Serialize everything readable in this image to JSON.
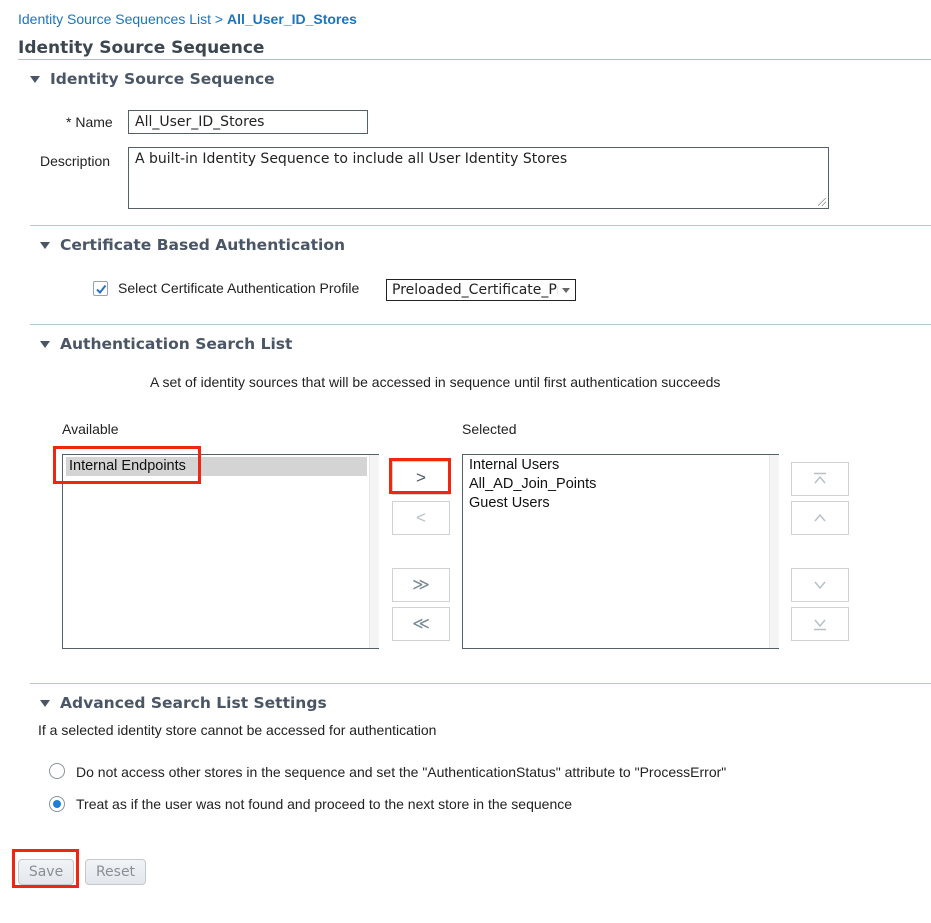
{
  "breadcrumb": {
    "parent": "Identity Source Sequences List",
    "separator": ">",
    "current": "All_User_ID_Stores"
  },
  "page_title": "Identity Source Sequence",
  "sections": {
    "identity": {
      "title": "Identity Source Sequence",
      "name_label": "* Name",
      "name_value": "All_User_ID_Stores",
      "description_label": "Description",
      "description_value": "A built-in Identity Sequence to include all User Identity Stores"
    },
    "certificate": {
      "title": "Certificate Based Authentication",
      "checkbox_label": "Select Certificate Authentication Profile",
      "checkbox_checked": true,
      "profile_selected": "Preloaded_Certificate_Pr"
    },
    "search_list": {
      "title": "Authentication Search List",
      "description": "A set of identity sources that will be accessed in sequence until first authentication succeeds",
      "available_label": "Available",
      "selected_label": "Selected",
      "available_items": [
        "Internal Endpoints"
      ],
      "selected_items": [
        "Internal Users",
        "All_AD_Join_Points",
        "Guest Users"
      ],
      "move_buttons": {
        "add": ">",
        "remove": "<",
        "add_all": "≫",
        "remove_all": "≪"
      },
      "order_buttons": {
        "top": "⤒",
        "up": "^",
        "down": "v",
        "bottom": "⤓"
      }
    },
    "advanced": {
      "title": "Advanced Search List Settings",
      "intro": "If a selected identity store cannot be accessed for authentication",
      "options": [
        {
          "label": "Do not access other stores in the sequence and set the \"AuthenticationStatus\" attribute to \"ProcessError\"",
          "selected": false
        },
        {
          "label": "Treat as if the user was not found and proceed to the next store in the sequence",
          "selected": true
        }
      ]
    }
  },
  "actions": {
    "save_label": "Save",
    "reset_label": "Reset"
  },
  "colors": {
    "link": "#1b75bb",
    "highlight_box": "#f0260f",
    "radio_selected": "#1e7fd6",
    "section_heading": "#4a5666"
  }
}
